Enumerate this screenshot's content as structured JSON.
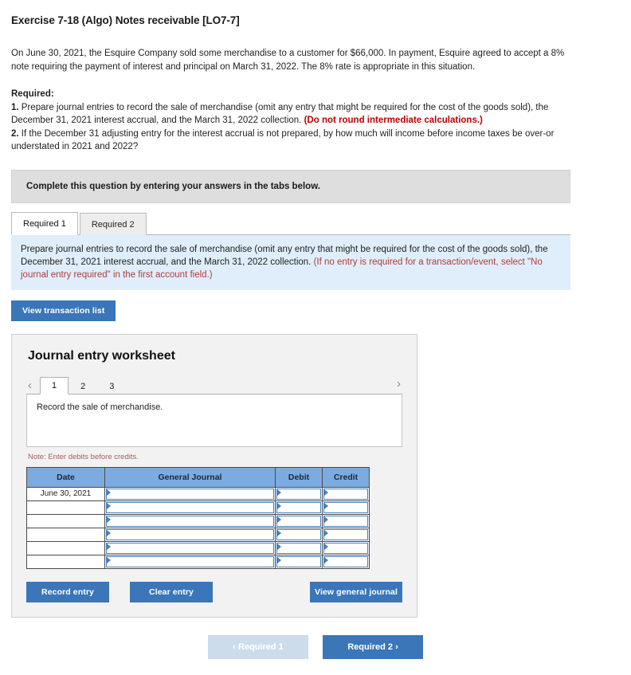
{
  "exercise": {
    "title": "Exercise 7-18 (Algo) Notes receivable [LO7-7]",
    "problem_text": "On June 30, 2021, the Esquire Company sold some merchandise to a customer for $66,000. In payment, Esquire agreed to accept a 8% note requiring the payment of interest and principal on March 31, 2022. The 8% rate is appropriate in this situation.",
    "required_label": "Required:",
    "req1_num": "1.",
    "req1_text": "Prepare journal entries to record the sale of merchandise (omit any entry that might be required for the cost of the goods sold), the December 31, 2021 interest accrual, and the March 31, 2022 collection.",
    "req1_emphasis": "(Do not round intermediate calculations.)",
    "req2_num": "2.",
    "req2_text": "If the December 31 adjusting entry for the interest accrual is not prepared, by how much will income before income taxes be over-or understated in 2021 and 2022?"
  },
  "banner": {
    "text": "Complete this question by entering your answers in the tabs below."
  },
  "tabs": [
    {
      "label": "Required 1",
      "active": true
    },
    {
      "label": "Required 2",
      "active": false
    }
  ],
  "instruction": {
    "main": "Prepare journal entries to record the sale of merchandise (omit any entry that might be required for the cost of the goods sold), the December 31, 2021 interest accrual, and the March 31, 2022 collection.",
    "hint": "(If no entry is required for a transaction/event, select \"No journal entry required\" in the first account field.)"
  },
  "view_transaction_list_label": "View transaction list",
  "worksheet": {
    "title": "Journal entry worksheet",
    "prev_arrow": "‹",
    "next_arrow": "›",
    "pages": [
      {
        "label": "1",
        "active": true
      },
      {
        "label": "2",
        "active": false
      },
      {
        "label": "3",
        "active": false
      }
    ],
    "description": "Record the sale of merchandise.",
    "note": "Note: Enter debits before credits.",
    "table": {
      "headers": [
        "Date",
        "General Journal",
        "Debit",
        "Credit"
      ],
      "rows": [
        {
          "date": "June 30, 2021",
          "general_journal": "",
          "debit": "",
          "credit": ""
        },
        {
          "date": "",
          "general_journal": "",
          "debit": "",
          "credit": ""
        },
        {
          "date": "",
          "general_journal": "",
          "debit": "",
          "credit": ""
        },
        {
          "date": "",
          "general_journal": "",
          "debit": "",
          "credit": ""
        },
        {
          "date": "",
          "general_journal": "",
          "debit": "",
          "credit": ""
        },
        {
          "date": "",
          "general_journal": "",
          "debit": "",
          "credit": ""
        }
      ]
    },
    "buttons": {
      "record_entry": "Record entry",
      "clear_entry": "Clear entry",
      "view_general_journal": "View general journal"
    }
  },
  "bottom_nav": {
    "prev_label": "Required 1",
    "next_label": "Required 2",
    "prev_chevron": "‹",
    "next_chevron": "›"
  },
  "colors": {
    "accent_blue": "#3a76b8",
    "table_header_blue": "#7cabdf",
    "instruction_bg": "#dfeefa",
    "banner_bg": "#dedede",
    "panel_bg": "#f2f2f2",
    "emphasis_red": "#c00000",
    "hint_red": "#b23b3b",
    "note_red": "#a6605e",
    "disabled_nav": "#cddcea"
  }
}
